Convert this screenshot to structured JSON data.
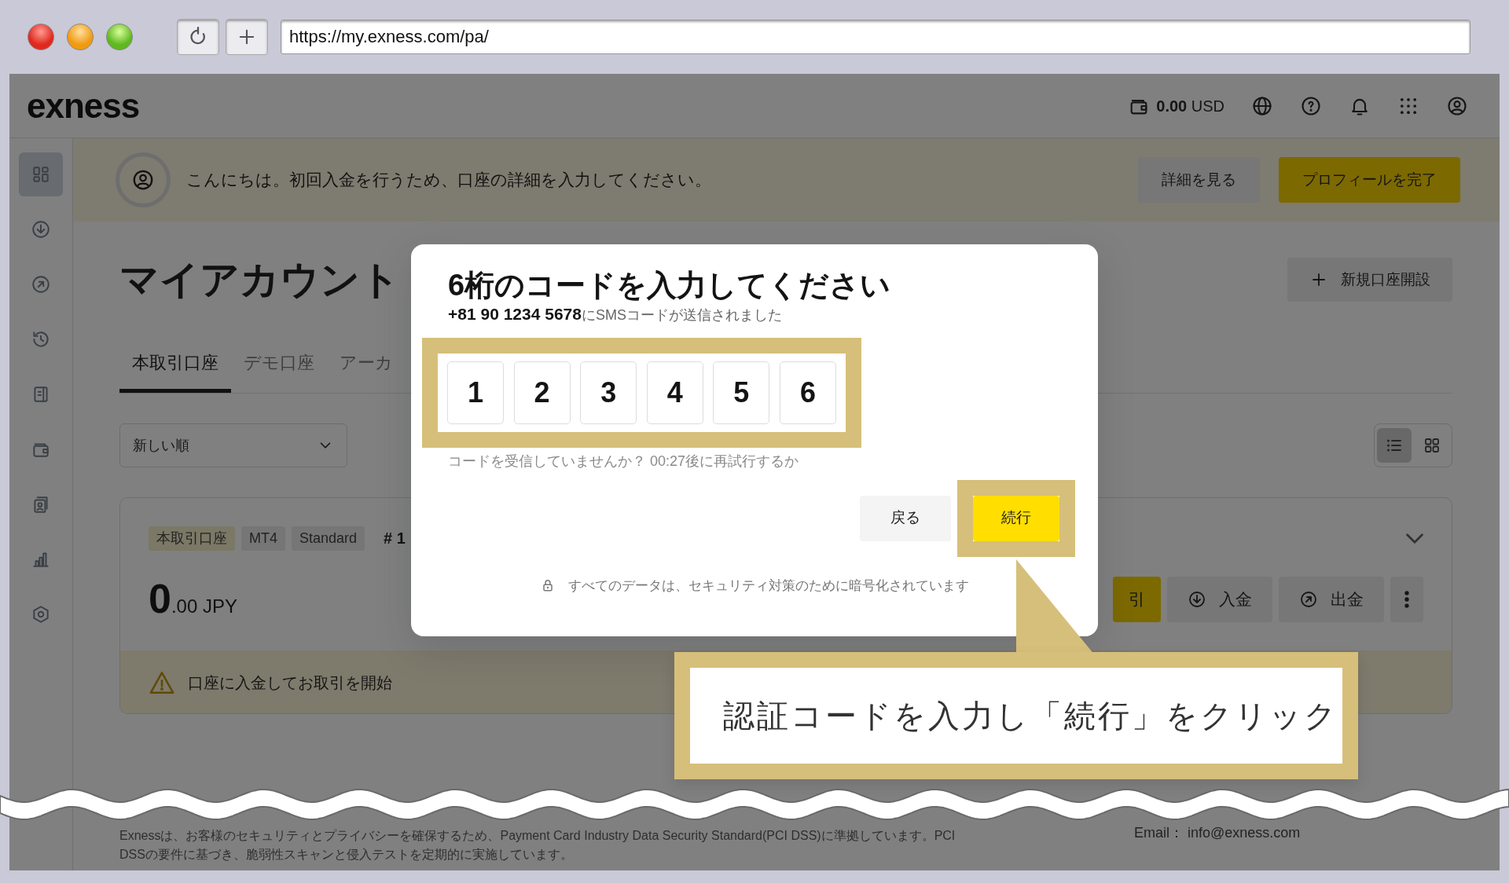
{
  "browser": {
    "url": "https://my.exness.com/pa/"
  },
  "header": {
    "logo": "exness",
    "balance_amount": "0.00",
    "balance_currency": "USD"
  },
  "sidebar": {
    "items": [
      {
        "selected": true
      },
      {
        "selected": false
      },
      {
        "selected": false
      },
      {
        "selected": false
      },
      {
        "selected": false
      },
      {
        "selected": false
      },
      {
        "selected": false
      },
      {
        "selected": false
      },
      {
        "selected": false
      }
    ]
  },
  "banner": {
    "message": "こんにちは。初回入金を行うため、口座の詳細を入力してください。",
    "buttons": [
      {
        "label": "詳細を見る",
        "kind": "secondary"
      },
      {
        "label": "プロフィールを完了",
        "kind": "primary"
      }
    ]
  },
  "page": {
    "title": "マイアカウント",
    "new_account_button": "新規口座開設"
  },
  "tabs": [
    {
      "label": "本取引口座",
      "selected": true
    },
    {
      "label": "デモ口座",
      "selected": false
    },
    {
      "label": "アーカ",
      "selected": false
    }
  ],
  "sort": {
    "value": "新しい順"
  },
  "view_toggle": [
    {
      "kind": "list",
      "selected": true
    },
    {
      "kind": "grid",
      "selected": false
    }
  ],
  "account_card": {
    "tags": [
      {
        "label": "本取引口座",
        "kind": "type"
      },
      {
        "label": "MT4",
        "kind": "plain"
      },
      {
        "label": "Standard",
        "kind": "plain"
      }
    ],
    "number": "# 1",
    "balance_whole": "0",
    "balance_rest": ".00 JPY",
    "actions": [
      {
        "label": "引",
        "kind": "primary"
      },
      {
        "label": "入金",
        "kind": "deposit"
      },
      {
        "label": "出金",
        "kind": "withdraw"
      }
    ],
    "notice": "口座に入金してお取引を開始"
  },
  "footer": {
    "lines": [
      "Exnessは、お客様のセキュリティとプライバシーを確保するため、Payment Card Industry Data Security Standard(PCI DSS)に準拠しています。PCI",
      "DSSの要件に基づき、脆弱性スキャンと侵入テストを定期的に実施しています。"
    ],
    "email": "Email： info@exness.com"
  },
  "modal": {
    "title": "6桁のコードを入力してください",
    "message": "**+81 90 1234 5678**にSMSコードが送信されました",
    "code": [
      "1",
      "2",
      "3",
      "4",
      "5",
      "6"
    ],
    "resend": "コードを受信していませんか？ 00:27後に再試行するか",
    "buttons": [
      {
        "label": "戻る",
        "kind": "secondary"
      },
      {
        "label": "続行",
        "kind": "primary"
      }
    ],
    "security_note": "すべてのデータは、セキュリティ対策のために暗号化されています"
  },
  "annotation": {
    "text": "認証コードを入力し「続行」をクリック"
  }
}
